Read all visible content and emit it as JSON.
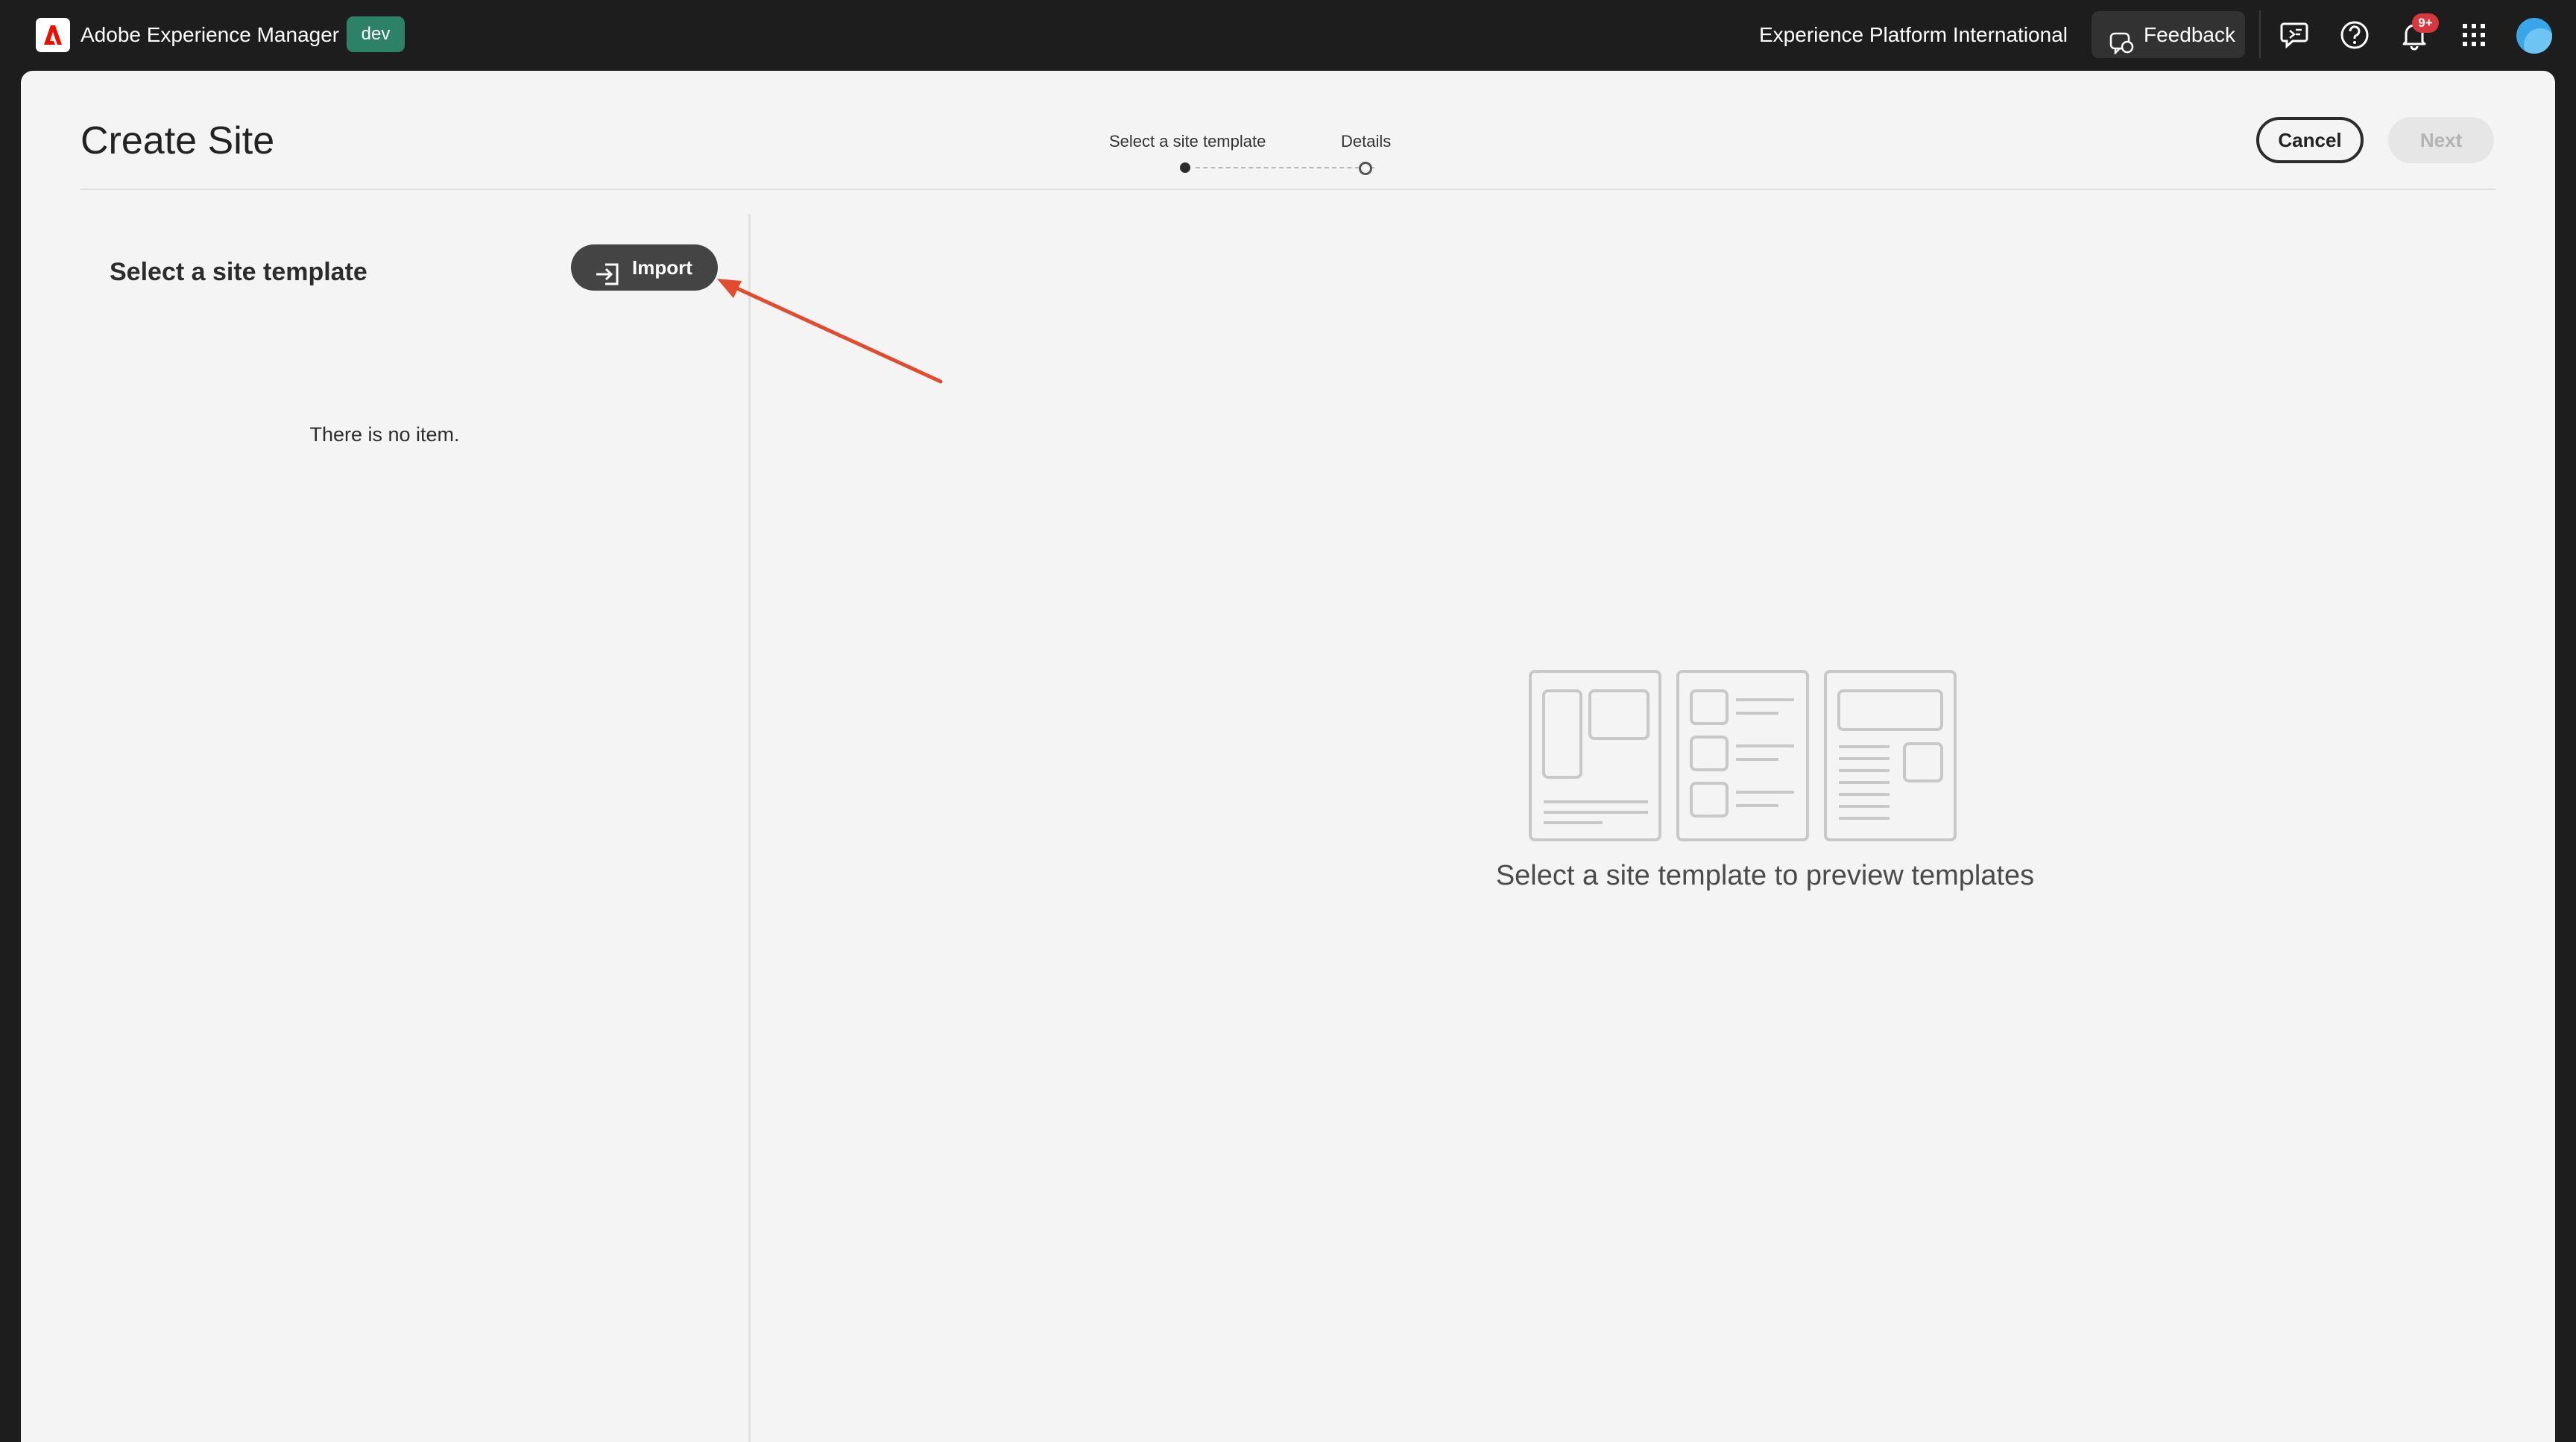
{
  "shell": {
    "app_name": "Adobe Experience Manager",
    "environment_badge": "dev",
    "org_name": "Experience Platform International",
    "feedback_label": "Feedback",
    "notification_count": "9+",
    "icons": [
      "adobe-logo-icon",
      "feedback-icon",
      "chat-icon",
      "help-icon",
      "bell-icon",
      "app-switcher-icon",
      "avatar"
    ]
  },
  "wizard": {
    "title": "Create Site",
    "steps": [
      {
        "label": "Select a site template",
        "state": "current"
      },
      {
        "label": "Details",
        "state": "pending"
      }
    ],
    "cancel_label": "Cancel",
    "next_label": "Next",
    "next_enabled": false
  },
  "template_panel": {
    "heading": "Select a site template",
    "import_label": "Import",
    "empty_message": "There is no item."
  },
  "preview": {
    "placeholder_text": "Select a site template to preview templates"
  },
  "colors": {
    "shell_bg": "#1d1d1d",
    "badge_green": "#2d8166",
    "panel_bg": "#f4f4f4",
    "annotation_red": "#e34b2f",
    "notification_red": "#d7373f"
  }
}
